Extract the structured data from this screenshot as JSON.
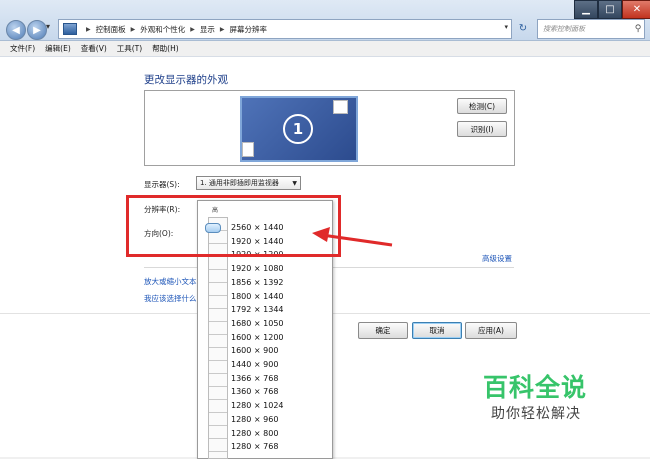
{
  "window": {
    "title_controls": {
      "minimize": "▁",
      "maximize": "□",
      "close": "✕"
    }
  },
  "address_bar": {
    "crumbs": [
      "控制面板",
      "外观和个性化",
      "显示",
      "屏幕分辨率"
    ],
    "search_placeholder": "搜索控制面板"
  },
  "menu": [
    "文件(F)",
    "编辑(E)",
    "查看(V)",
    "工具(T)",
    "帮助(H)"
  ],
  "main": {
    "title": "更改显示器的外观",
    "monitor_number": "1",
    "detect_button": "检测(C)",
    "identify_button": "识别(I)",
    "display_label": "显示器(S):",
    "display_value": "1. 通用非即插即用监视器",
    "resolution_label": "分辨率(R):",
    "orientation_label": "方向(O):",
    "advanced_link": "高级设置",
    "link_text_size": "放大或缩小文本",
    "link_help": "我应该选择什么",
    "ok_button": "确定",
    "cancel_button": "取消",
    "apply_button": "应用(A)"
  },
  "resolution_dropdown": {
    "high_label": "高",
    "options": [
      "2560 × 1440",
      "1920 × 1440",
      "1920 × 1200",
      "1920 × 1080",
      "1856 × 1392",
      "1800 × 1440",
      "1792 × 1344",
      "1680 × 1050",
      "1600 × 1200",
      "1600 × 900",
      "1440 × 900",
      "1366 × 768",
      "1360 × 768",
      "1280 × 1024",
      "1280 × 960",
      "1280 × 800",
      "1280 × 768"
    ]
  },
  "watermark": {
    "title": "百科全说",
    "subtitle": "助你轻松解决"
  },
  "colors": {
    "annotation_red": "#e02a2a",
    "link_blue": "#1e56b8",
    "watermark_green": "#37c46a"
  }
}
